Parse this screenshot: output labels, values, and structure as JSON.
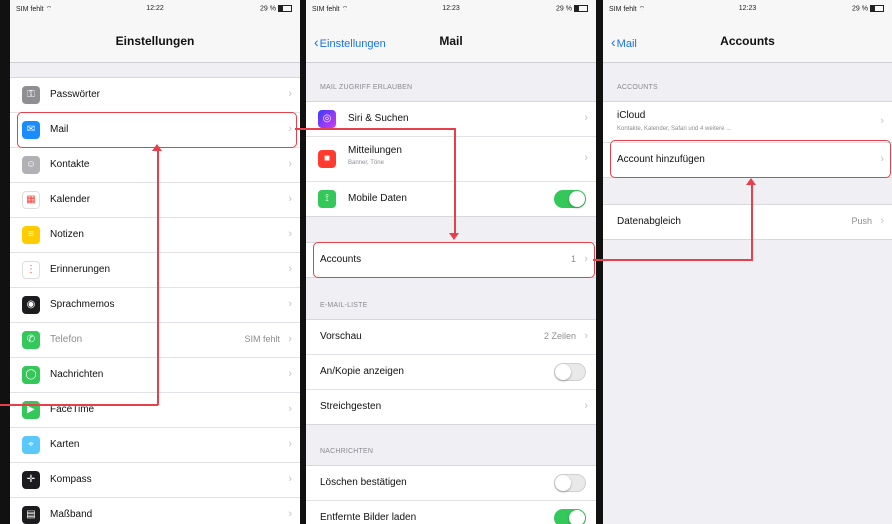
{
  "status": {
    "carrier": "SIM fehlt ⌔",
    "battery": "29 %",
    "time1": "12:22",
    "time2": "12:23",
    "time3": "12:23"
  },
  "screen1": {
    "title": "Einstellungen",
    "items": [
      {
        "label": "Passwörter",
        "icon": "key-icon",
        "color": "#8e8e93",
        "glyph": "⚿"
      },
      {
        "label": "Mail",
        "icon": "mail-icon",
        "color": "#1a8cff",
        "glyph": "✉"
      },
      {
        "label": "Kontakte",
        "icon": "contacts-icon",
        "color": "#b0b0b5",
        "glyph": "☺"
      },
      {
        "label": "Kalender",
        "icon": "calendar-icon",
        "color": "#ffffff",
        "glyph": "▦"
      },
      {
        "label": "Notizen",
        "icon": "notes-icon",
        "color": "#ffcc00",
        "glyph": "≡"
      },
      {
        "label": "Erinnerungen",
        "icon": "reminders-icon",
        "color": "#ffffff",
        "glyph": "⋮"
      },
      {
        "label": "Sprachmemos",
        "icon": "voice-memos-icon",
        "color": "#1c1c1e",
        "glyph": "◉"
      },
      {
        "label": "Telefon",
        "icon": "phone-icon",
        "color": "#34c759",
        "glyph": "✆",
        "value": "SIM fehlt",
        "disabled": true
      },
      {
        "label": "Nachrichten",
        "icon": "messages-icon",
        "color": "#34c759",
        "glyph": "◯"
      },
      {
        "label": "FaceTime",
        "icon": "facetime-icon",
        "color": "#34c759",
        "glyph": "▶"
      },
      {
        "label": "Karten",
        "icon": "maps-icon",
        "color": "#5ac8fa",
        "glyph": "⌖"
      },
      {
        "label": "Kompass",
        "icon": "compass-icon",
        "color": "#1c1c1e",
        "glyph": "✛"
      },
      {
        "label": "Maßband",
        "icon": "measure-icon",
        "color": "#1c1c1e",
        "glyph": "▤"
      }
    ]
  },
  "screen2": {
    "back": "Einstellungen",
    "title": "Mail",
    "section_access": "MAIL ZUGRIFF ERLAUBEN",
    "siri": "Siri & Suchen",
    "notifications": "Mitteilungen",
    "notifications_sub": "Banner, Töne",
    "mobile_data": "Mobile Daten",
    "accounts": "Accounts",
    "accounts_count": "1",
    "section_list": "E-MAIL-LISTE",
    "preview": "Vorschau",
    "preview_value": "2 Zeilen",
    "cc": "An/Kopie anzeigen",
    "swipe": "Streichgesten",
    "section_messages": "NACHRICHTEN",
    "confirm_delete": "Löschen bestätigen",
    "remote_images": "Entfernte Bilder laden"
  },
  "screen3": {
    "back": "Mail",
    "title": "Accounts",
    "section": "ACCOUNTS",
    "icloud": "iCloud",
    "icloud_sub": "Kontakte, Kalender, Safari und 4 weitere ...",
    "add_account": "Account hinzufügen",
    "fetch": "Datenabgleich",
    "fetch_value": "Push"
  },
  "colors": {
    "highlight": "#e8404a",
    "accent": "#1a73e8",
    "toggle_on": "#34c759"
  }
}
